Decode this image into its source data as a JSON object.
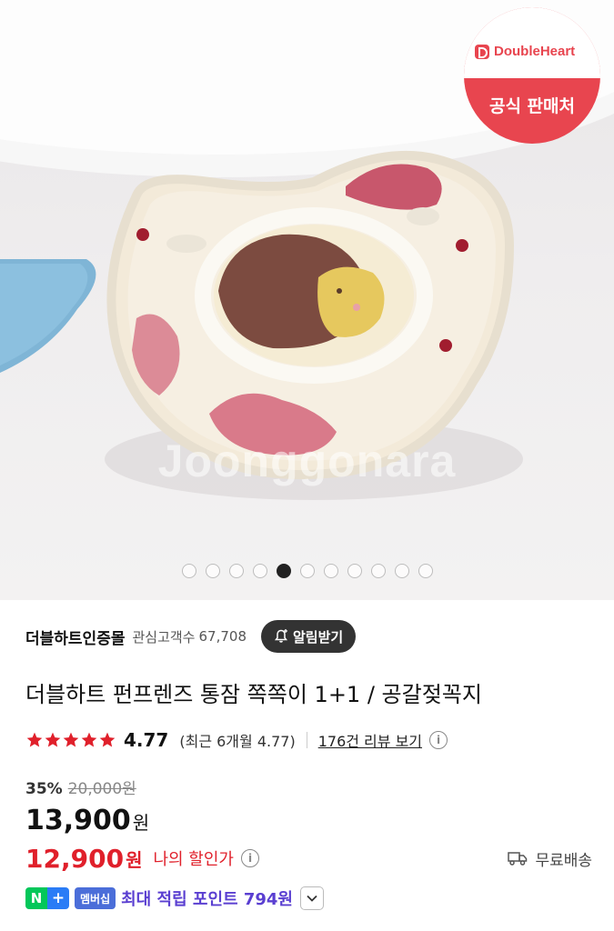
{
  "hero": {
    "watermark": "Joonggonara",
    "badge_brand": "DoubleHeart",
    "badge_label": "공식 판매처",
    "carousel": {
      "total": 11,
      "active_index": 4
    }
  },
  "store": {
    "name": "더블하트인증몰",
    "favorites_label": "관심고객수",
    "favorites_count": "67,708",
    "alarm_button": "알림받기"
  },
  "product": {
    "title": "더블하트 펀프렌즈 통잠 쪽쪽이 1+1 / 공갈젖꼭지"
  },
  "rating": {
    "stars": 5,
    "score": "4.77",
    "recent": "(최근 6개월 4.77)",
    "review_link": "176건 리뷰 보기"
  },
  "price": {
    "discount_rate": "35%",
    "original": "20,000원",
    "sale": "13,900",
    "sale_unit": "원",
    "my_price": "12,900",
    "my_unit": "원",
    "my_label": "나의 할인가",
    "shipping": "무료배송"
  },
  "membership": {
    "n_label": "N",
    "plus_label": "+",
    "badge": "멤버십",
    "points_text": "최대 적립 포인트 794원"
  },
  "colors": {
    "accent_red": "#e0202b",
    "badge_red": "#e8454f",
    "points_purple": "#5a3fd1",
    "naver_green": "#03c75a",
    "naver_blue": "#2a7cf6"
  }
}
